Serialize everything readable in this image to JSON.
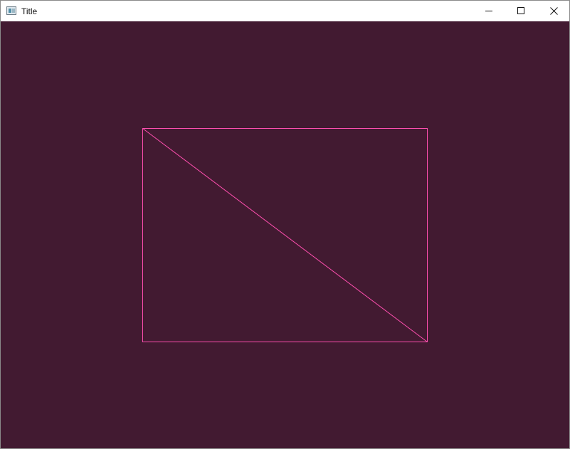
{
  "window": {
    "title": "Title",
    "icon": "app-window-icon",
    "controls": {
      "minimize": "minimize-icon",
      "maximize": "maximize-icon",
      "close": "close-icon"
    }
  },
  "canvas": {
    "background_color": "#421a31",
    "stroke_color": "#ff4fb0",
    "shapes": [
      "rectangle-outline",
      "diagonal-line"
    ]
  }
}
